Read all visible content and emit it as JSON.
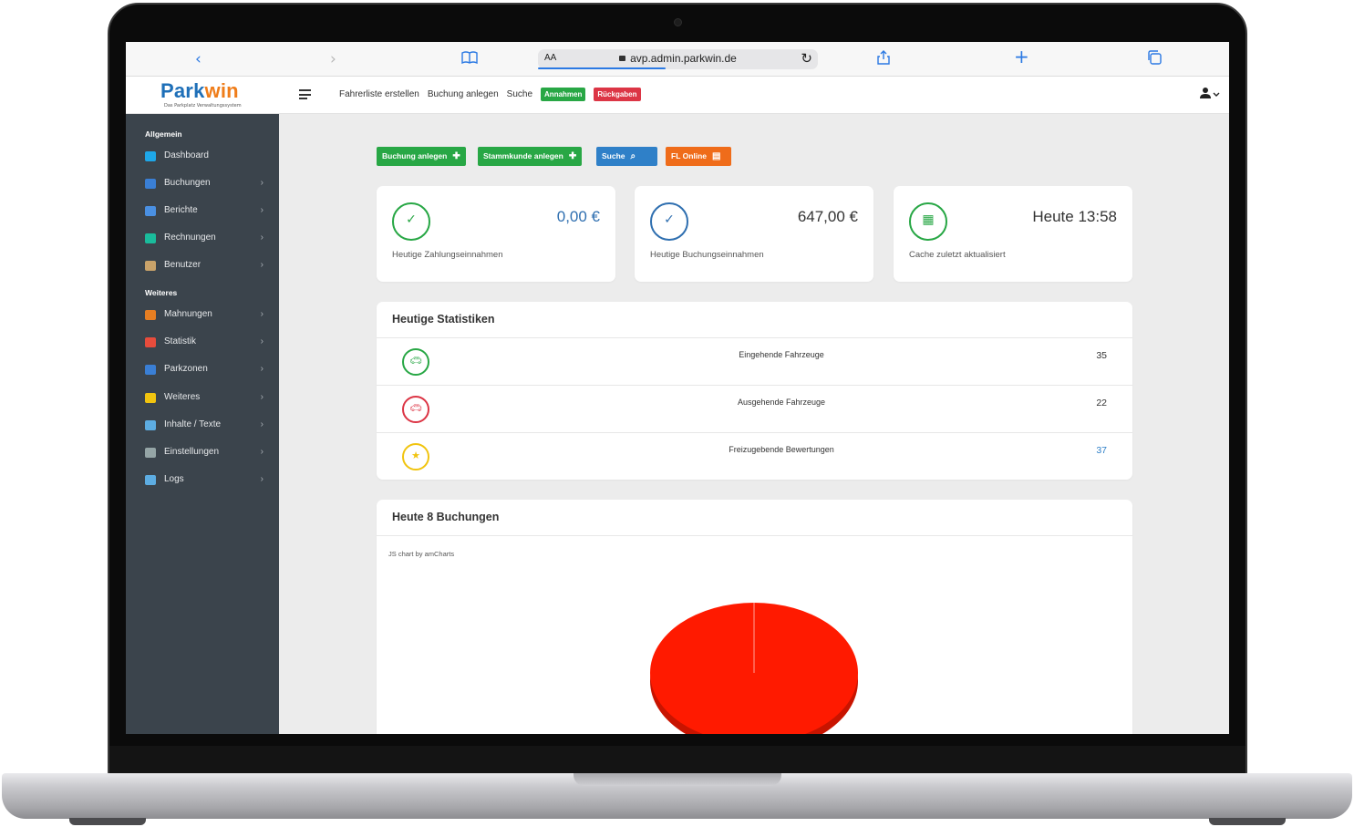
{
  "browser": {
    "text_size_label": "AA",
    "url": "avp.admin.parkwin.de"
  },
  "app": {
    "logo_text_blue": "Park",
    "logo_text_orange": "win",
    "logo_tagline": "Das Parkplatz Verwaltungssystem"
  },
  "topnav": {
    "fahrerliste": "Fahrerliste erstellen",
    "buchung_anlegen": "Buchung anlegen",
    "suche": "Suche",
    "annahmen": "Annahmen",
    "rueckgaben": "Rückgaben"
  },
  "sidebar": {
    "section_allgemein": "Allgemein",
    "section_weiteres": "Weiteres",
    "items": [
      {
        "label": "Dashboard",
        "icon": "dashboard-icon",
        "color": "#1ea7e8",
        "chevron": false
      },
      {
        "label": "Buchungen",
        "icon": "parking-icon",
        "color": "#3a7fd5",
        "chevron": true
      },
      {
        "label": "Berichte",
        "icon": "report-icon",
        "color": "#4a90e2",
        "chevron": true
      },
      {
        "label": "Rechnungen",
        "icon": "invoice-icon",
        "color": "#1abc9c",
        "chevron": true
      },
      {
        "label": "Benutzer",
        "icon": "users-icon",
        "color": "#c9a36a",
        "chevron": true
      },
      {
        "label": "Mahnungen",
        "icon": "dunning-icon",
        "color": "#e67e22",
        "chevron": true
      },
      {
        "label": "Statistik",
        "icon": "statistics-icon",
        "color": "#e74c3c",
        "chevron": true
      },
      {
        "label": "Parkzonen",
        "icon": "parking-zone-icon",
        "color": "#3a7fd5",
        "chevron": true
      },
      {
        "label": "Weiteres",
        "icon": "more-icon",
        "color": "#f1c40f",
        "chevron": true
      },
      {
        "label": "Inhalte / Texte",
        "icon": "content-icon",
        "color": "#5dade2",
        "chevron": true
      },
      {
        "label": "Einstellungen",
        "icon": "settings-icon",
        "color": "#95a5a6",
        "chevron": true
      },
      {
        "label": "Logs",
        "icon": "logs-icon",
        "color": "#5dade2",
        "chevron": true
      }
    ]
  },
  "actions": {
    "buchung_anlegen": "Buchung anlegen",
    "stammkunde_anlegen": "Stammkunde anlegen",
    "suche": "Suche",
    "fl_online": "FL Online"
  },
  "kpis": [
    {
      "value": "0,00 €",
      "label": "Heutige Zahlungseinnahmen",
      "color": "#28a745",
      "value_color": "#2f6fb0",
      "icon": "check-icon"
    },
    {
      "value": "647,00 €",
      "label": "Heutige Buchungseinnahmen",
      "color": "#2f6fb0",
      "value_color": "#333333",
      "icon": "check-icon"
    },
    {
      "value": "Heute 13:58",
      "label": "Cache zuletzt aktualisiert",
      "color": "#28a745",
      "value_color": "#333333",
      "icon": "calendar-icon"
    }
  ],
  "stats": {
    "title": "Heutige Statistiken",
    "rows": [
      {
        "name": "Eingehende Fahrzeuge",
        "value": "35",
        "color": "#28a745",
        "icon": "car-icon"
      },
      {
        "name": "Ausgehende Fahrzeuge",
        "value": "22",
        "color": "#dc3545",
        "icon": "car-icon"
      },
      {
        "name": "Freizugebende Bewertungen",
        "value": "37",
        "color": "#f1c40f",
        "icon": "star-icon"
      }
    ]
  },
  "bookings": {
    "title": "Heute 8 Buchungen",
    "credit": "JS chart by amCharts"
  },
  "chart_data": {
    "type": "pie",
    "title": "Heute 8 Buchungen",
    "slices": [
      {
        "value": 8,
        "color": "#ff1a00"
      }
    ]
  }
}
